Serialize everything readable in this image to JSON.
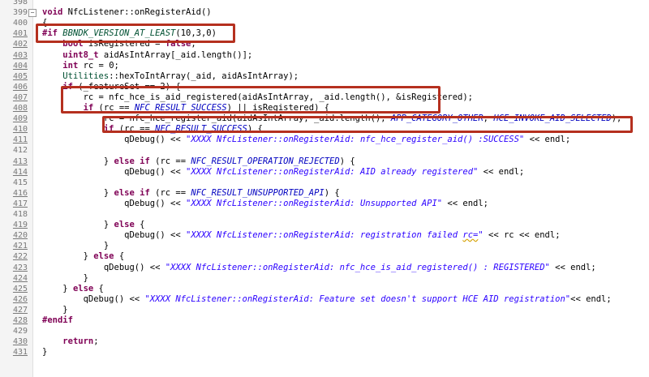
{
  "editor": {
    "lines": [
      {
        "n": "398",
        "text": ""
      },
      {
        "n": "399",
        "text": "void NfcListener::onRegisterAid()"
      },
      {
        "n": "400",
        "text": "{"
      },
      {
        "n": "401",
        "text": "#if BBNDK_VERSION_AT_LEAST(10,3,0)"
      },
      {
        "n": "402",
        "text": "    bool isRegistered = false;"
      },
      {
        "n": "403",
        "text": "    uint8_t aidAsIntArray[_aid.length()];"
      },
      {
        "n": "404",
        "text": "    int rc = 0;"
      },
      {
        "n": "405",
        "text": "    Utilities::hexToIntArray(_aid, aidAsIntArray);"
      },
      {
        "n": "406",
        "text": "    if (_featureSet == 2) {"
      },
      {
        "n": "407",
        "text": "        rc = nfc_hce_is_aid_registered(aidAsIntArray, _aid.length(), &isRegistered);"
      },
      {
        "n": "408",
        "text": "        if (rc == NFC_RESULT_SUCCESS) || isRegistered) {"
      },
      {
        "n": "409",
        "text": "            rc = nfc_hce_register_aid(aidAsIntArray, _aid.length(), APP_CATEGORY_OTHER, HCE_INVOKE_AID_SELECTED);"
      },
      {
        "n": "410",
        "text": "            if (rc == NFC_RESULT_SUCCESS) {"
      },
      {
        "n": "411",
        "text": "                qDebug() << \"XXXX NfcListener::onRegisterAid: nfc_hce_register_aid() :SUCCESS\" << endl;"
      },
      {
        "n": "412",
        "text": ""
      },
      {
        "n": "413",
        "text": "            } else if (rc == NFC_RESULT_OPERATION_REJECTED) {"
      },
      {
        "n": "414",
        "text": "                qDebug() << \"XXXX NfcListener::onRegisterAid: AID already registered\" << endl;"
      },
      {
        "n": "415",
        "text": ""
      },
      {
        "n": "416",
        "text": "            } else if (rc == NFC_RESULT_UNSUPPORTED_API) {"
      },
      {
        "n": "417",
        "text": "                qDebug() << \"XXXX NfcListener::onRegisterAid: Unsupported API\" << endl;"
      },
      {
        "n": "418",
        "text": ""
      },
      {
        "n": "419",
        "text": "            } else {"
      },
      {
        "n": "420",
        "text": "                qDebug() << \"XXXX NfcListener::onRegisterAid: registration failed rc=\" << rc << endl;"
      },
      {
        "n": "421",
        "text": "            }"
      },
      {
        "n": "422",
        "text": "        } else {"
      },
      {
        "n": "423",
        "text": "            qDebug() << \"XXXX NfcListener::onRegisterAid: nfc_hce_is_aid_registered() : REGISTERED\" << endl;"
      },
      {
        "n": "424",
        "text": "        }"
      },
      {
        "n": "425",
        "text": "    } else {"
      },
      {
        "n": "426",
        "text": "        qDebug() << \"XXXX NfcListener::onRegisterAid: Feature set doesn't support HCE AID registration\"<< endl;"
      },
      {
        "n": "427",
        "text": "    }"
      },
      {
        "n": "428",
        "text": "#endif"
      },
      {
        "n": "429",
        "text": ""
      },
      {
        "n": "430",
        "text": "    return;"
      },
      {
        "n": "431",
        "text": "}"
      }
    ],
    "colors": {
      "keyword": "#7f0055",
      "string": "#2a00ff",
      "enum": "#0000c0",
      "highlight_box": "#b5301f",
      "line_number": "#787878"
    }
  }
}
